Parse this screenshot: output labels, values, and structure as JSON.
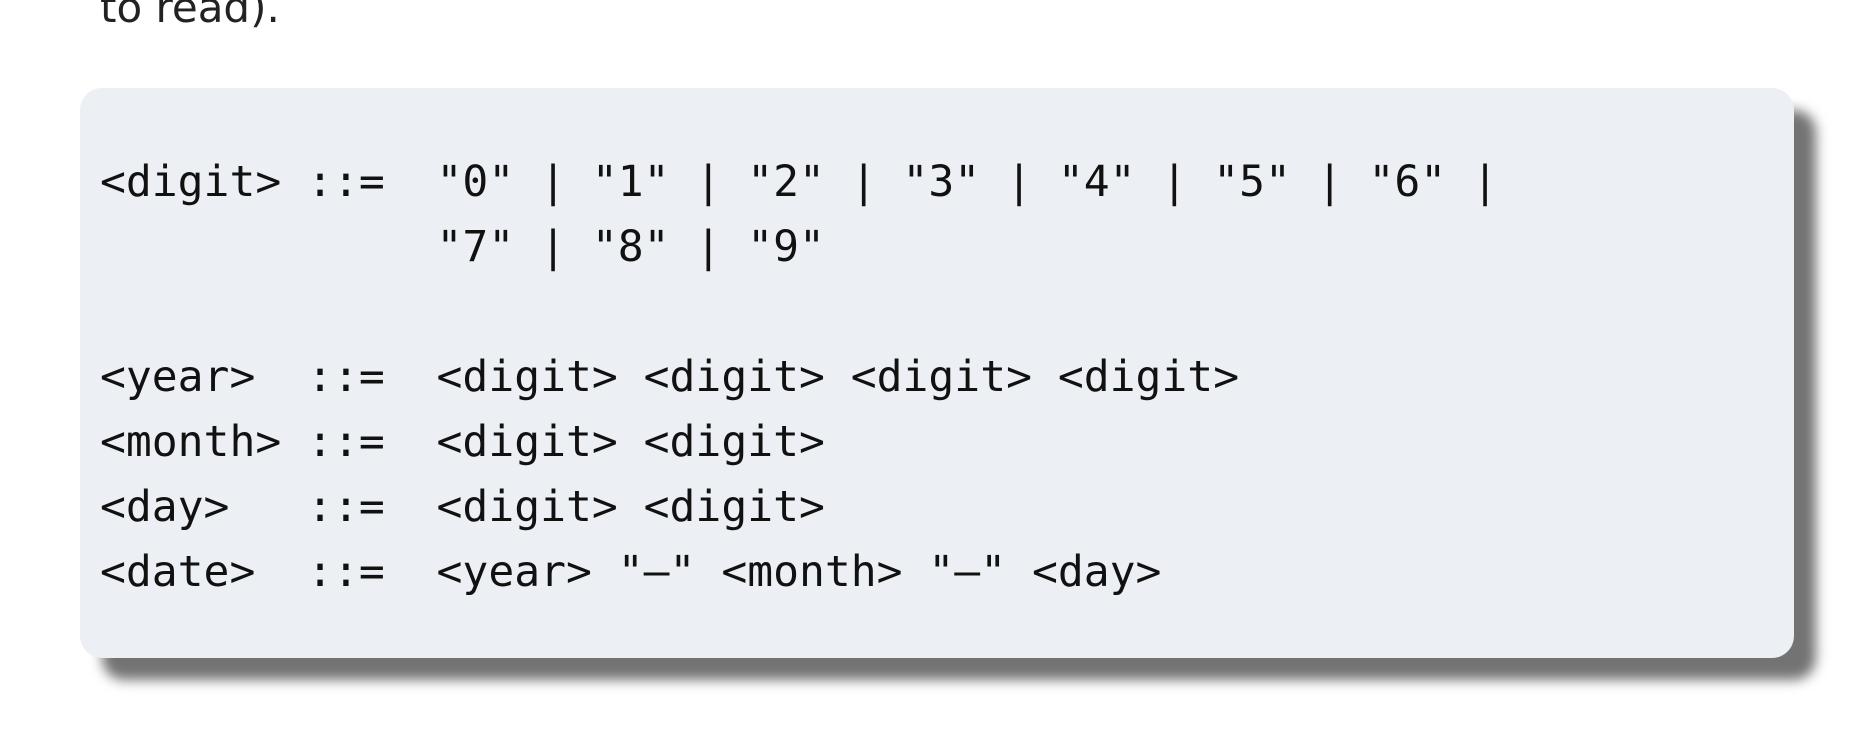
{
  "intro": {
    "text": "to read)."
  },
  "grammar": {
    "lines": [
      "<digit> ::=  \"0\" | \"1\" | \"2\" | \"3\" | \"4\" | \"5\" | \"6\" |",
      "             \"7\" | \"8\" | \"9\"",
      "",
      "<year>  ::=  <digit> <digit> <digit> <digit>",
      "<month> ::=  <digit> <digit>",
      "<day>   ::=  <digit> <digit>",
      "<date>  ::=  <year> \"—\" <month> \"—\" <day>"
    ]
  }
}
